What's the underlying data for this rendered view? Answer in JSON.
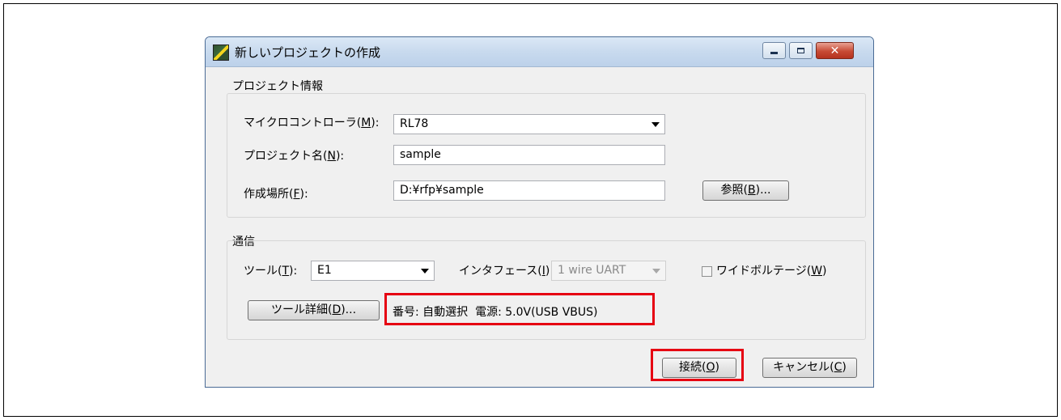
{
  "window": {
    "title": "新しいプロジェクトの作成"
  },
  "project_info": {
    "group_title": "プロジェクト情報",
    "microcontroller": {
      "label_prefix": "マイクロコントローラ(",
      "mnemonic": "M",
      "label_suffix": "):",
      "value": "RL78"
    },
    "project_name": {
      "label_prefix": "プロジェクト名(",
      "mnemonic": "N",
      "label_suffix": "):",
      "value": "sample"
    },
    "location": {
      "label_prefix": "作成場所(",
      "mnemonic": "F",
      "label_suffix": "):",
      "value": "D:¥rfp¥sample"
    },
    "browse_button": {
      "label_prefix": "参照(",
      "mnemonic": "B",
      "label_suffix": ")..."
    }
  },
  "communication": {
    "group_title": "通信",
    "tool": {
      "label_prefix": "ツール(",
      "mnemonic": "T",
      "label_suffix": "):",
      "value": "E1"
    },
    "interface": {
      "label_prefix": "インタフェース(",
      "mnemonic": "I",
      "label_suffix": "):",
      "value": "1 wire UART"
    },
    "wide_voltage": {
      "label_prefix": "ワイドボルテージ(",
      "mnemonic": "W",
      "label_suffix": ")",
      "checked": false
    },
    "tool_details_button": {
      "label_prefix": "ツール詳細(",
      "mnemonic": "D",
      "label_suffix": ")..."
    },
    "status_text": "番号: 自動選択  電源: 5.0V(USB VBUS)"
  },
  "footer": {
    "connect_button": {
      "label_prefix": "接続(",
      "mnemonic": "O",
      "label_suffix": ")"
    },
    "cancel_button": {
      "label_prefix": "キャンセル(",
      "mnemonic": "C",
      "label_suffix": ")"
    }
  },
  "colors": {
    "highlight": "#e60012",
    "titlebar": "#c8daee"
  }
}
